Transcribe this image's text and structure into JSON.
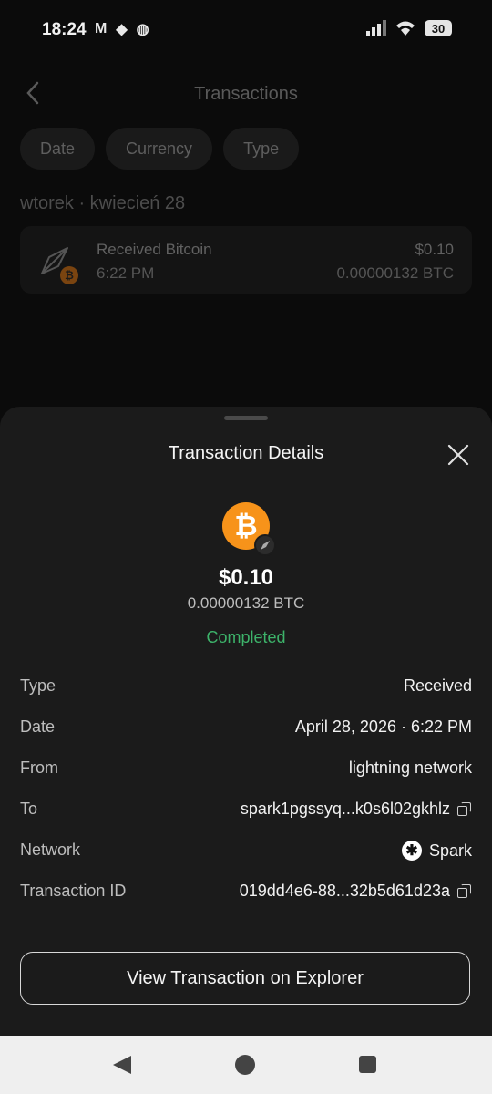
{
  "status_bar": {
    "time": "18:24",
    "battery": "30",
    "left_icons": [
      "gmail-icon",
      "diamond-icon",
      "circle-icon"
    ],
    "right_icons": [
      "signal-icon",
      "wifi-icon",
      "battery-icon"
    ]
  },
  "underlay": {
    "title": "Transactions",
    "filters": [
      "Date",
      "Currency",
      "Type"
    ],
    "date_header": "wtorek · kwiecień 28",
    "transaction": {
      "name": "Received Bitcoin",
      "time": "6:22 PM",
      "amount_usd": "$0.10",
      "amount_btc": "0.00000132 BTC"
    }
  },
  "sheet": {
    "title": "Transaction Details",
    "coin_symbol": "₿",
    "amount_usd": "$0.10",
    "amount_btc": "0.00000132 BTC",
    "status": "Completed",
    "details": {
      "type": {
        "label": "Type",
        "value": "Received"
      },
      "date": {
        "label": "Date",
        "value": "April 28, 2026 · 6:22 PM"
      },
      "from": {
        "label": "From",
        "value": "lightning network"
      },
      "to": {
        "label": "To",
        "value": "spark1pgssyq...k0s6l02gkhlz"
      },
      "network": {
        "label": "Network",
        "value": "Spark"
      },
      "txid": {
        "label": "Transaction ID",
        "value": "019dd4e6-88...32b5d61d23a"
      }
    },
    "button_label": "View Transaction on Explorer"
  },
  "colors": {
    "status_green": "#3db36a",
    "bitcoin_orange": "#f7931a",
    "sheet_bg": "#1b1b1b"
  }
}
